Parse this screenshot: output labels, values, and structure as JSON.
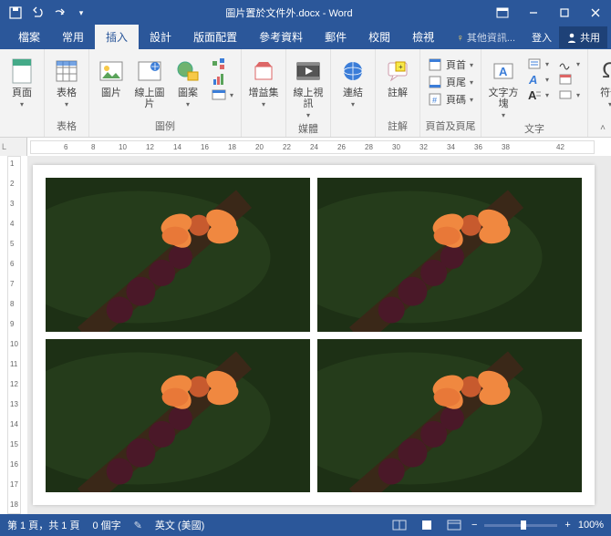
{
  "title": "圖片置於文件外.docx - Word",
  "qat": {
    "save": "儲存",
    "undo": "復原",
    "redo": "重做"
  },
  "tabs": {
    "file": "檔案",
    "home": "常用",
    "insert": "插入",
    "design": "設計",
    "layout": "版面配置",
    "references": "參考資料",
    "mailings": "郵件",
    "review": "校閱",
    "view": "檢視",
    "tellme": "其他資訊...",
    "signin": "登入",
    "share": "共用"
  },
  "ribbon": {
    "pages": {
      "group": "",
      "cover": "頁面"
    },
    "tables": {
      "group": "表格",
      "table": "表格"
    },
    "illustrations": {
      "group": "圖例",
      "pictures": "圖片",
      "online": "線上圖片",
      "shapes": "圖案"
    },
    "addins": {
      "group": "",
      "store": "增益集"
    },
    "media": {
      "group": "媒體",
      "video": "線上視訊"
    },
    "links": {
      "group": "",
      "link": "連結"
    },
    "comments": {
      "group": "註解",
      "comment": "註解"
    },
    "headerfooter": {
      "group": "頁首及頁尾",
      "header": "頁首",
      "footer": "頁尾",
      "pagenum": "頁碼"
    },
    "text": {
      "group": "文字",
      "textbox": "文字方塊"
    },
    "symbols": {
      "group": "",
      "symbol": "符號"
    }
  },
  "ruler_h": [
    1,
    61,
    81,
    101,
    121,
    141,
    161,
    181,
    201,
    221,
    241,
    261,
    281,
    301,
    321,
    341,
    361,
    381,
    401,
    421
  ],
  "ruler_h_lbl": [
    "",
    "6",
    "8",
    "10",
    "12",
    "14",
    "16",
    "18",
    "20",
    "22",
    "24",
    "26",
    "28",
    "30",
    "32",
    "34",
    "36",
    "38",
    "",
    "42"
  ],
  "ruler_v": [
    1,
    2,
    3,
    4,
    5,
    6,
    7,
    8,
    9,
    10,
    11,
    12,
    13,
    14,
    15,
    16,
    17,
    18
  ],
  "status": {
    "page": "第 1 頁，共 1 頁",
    "words": "0 個字",
    "lang": "英文 (美國)",
    "zoom": "100%"
  }
}
